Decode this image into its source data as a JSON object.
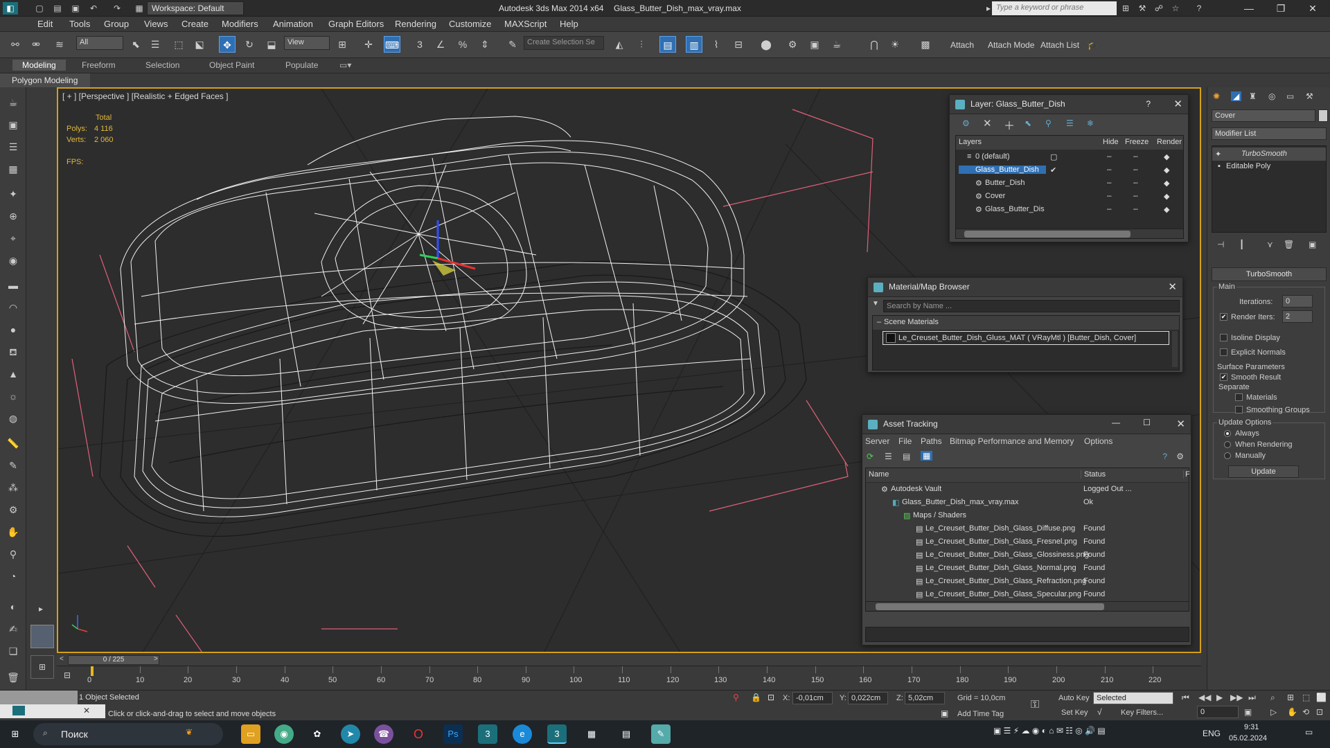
{
  "title_bar": {
    "app": "Autodesk 3ds Max  2014 x64",
    "file": "Glass_Butter_Dish_max_vray.max",
    "workspace": "Workspace: Default",
    "search_placeholder": "Type a keyword or phrase"
  },
  "menu": [
    "Edit",
    "Tools",
    "Group",
    "Views",
    "Create",
    "Modifiers",
    "Animation",
    "Graph Editors",
    "Rendering",
    "Customize",
    "MAXScript",
    "Help"
  ],
  "toolbar": {
    "filter": "All",
    "view": "View",
    "selection_set": "Create Selection Se",
    "attach": "Attach",
    "attach_mode": "Attach Mode",
    "attach_list": "Attach List"
  },
  "ribbon": {
    "tabs": [
      "Modeling",
      "Freeform",
      "Selection",
      "Object Paint",
      "Populate"
    ],
    "active": "Modeling",
    "panel": "Polygon Modeling"
  },
  "viewport": {
    "label": "[ + ] [Perspective ] [Realistic + Edged Faces ]",
    "stats_header": "Total",
    "polys_label": "Polys:",
    "polys": "4 116",
    "verts_label": "Verts:",
    "verts": "2 060",
    "fps_label": "FPS:"
  },
  "layer_window": {
    "title": "Layer: Glass_Butter_Dish",
    "help": "?",
    "columns": [
      "Layers",
      "Hide",
      "Freeze",
      "Render"
    ],
    "rows": [
      {
        "name": "0 (default)",
        "selected": false,
        "indent": 0
      },
      {
        "name": "Glass_Butter_Dish",
        "selected": true,
        "indent": 0
      },
      {
        "name": "Butter_Dish",
        "selected": false,
        "indent": 1
      },
      {
        "name": "Cover",
        "selected": false,
        "indent": 1
      },
      {
        "name": "Glass_Butter_Dis",
        "selected": false,
        "indent": 1
      }
    ]
  },
  "material_browser": {
    "title": "Material/Map Browser",
    "search_placeholder": "Search by Name ...",
    "section": "Scene Materials",
    "item": "Le_Creuset_Butter_Dish_Gluss_MAT  ( VRayMtl ) [Butter_Dish, Cover]"
  },
  "asset_tracking": {
    "title": "Asset Tracking",
    "menu": [
      "Server",
      "File",
      "Paths",
      "Bitmap Performance and Memory",
      "Options"
    ],
    "columns": [
      "Name",
      "Status",
      "F"
    ],
    "rows": [
      {
        "name": "Autodesk Vault",
        "status": "Logged Out ...",
        "indent": 1
      },
      {
        "name": "Glass_Butter_Dish_max_vray.max",
        "status": "Ok",
        "indent": 2
      },
      {
        "name": "Maps / Shaders",
        "status": "",
        "indent": 3
      },
      {
        "name": "Le_Creuset_Butter_Dish_Glass_Diffuse.png",
        "status": "Found",
        "indent": 4
      },
      {
        "name": "Le_Creuset_Butter_Dish_Glass_Fresnel.png",
        "status": "Found",
        "indent": 4
      },
      {
        "name": "Le_Creuset_Butter_Dish_Glass_Glossiness.png",
        "status": "Found",
        "indent": 4
      },
      {
        "name": "Le_Creuset_Butter_Dish_Glass_Normal.png",
        "status": "Found",
        "indent": 4
      },
      {
        "name": "Le_Creuset_Butter_Dish_Glass_Refraction.png",
        "status": "Found",
        "indent": 4
      },
      {
        "name": "Le_Creuset_Butter_Dish_Glass_Specular.png",
        "status": "Found",
        "indent": 4
      }
    ]
  },
  "command_panel": {
    "object_name": "Cover",
    "modifier_list": "Modifier List",
    "stack": [
      "TurboSmooth",
      "Editable Poly"
    ],
    "rollout_title": "TurboSmooth",
    "main_label": "Main",
    "iterations_label": "Iterations:",
    "iterations": "0",
    "render_iters_label": "Render Iters:",
    "render_iters": "2",
    "isoline_label": "Isoline Display",
    "explicit_normals_label": "Explicit Normals",
    "surface_params_label": "Surface Parameters",
    "smooth_result_label": "Smooth Result",
    "separate_label": "Separate",
    "materials_label": "Materials",
    "smoothing_groups_label": "Smoothing Groups",
    "update_options_label": "Update Options",
    "always_label": "Always",
    "when_rendering_label": "When Rendering",
    "manually_label": "Manually",
    "update_button": "Update"
  },
  "timeline": {
    "frame": "0 / 225",
    "ticks": [
      "0",
      "10",
      "20",
      "30",
      "40",
      "50",
      "60",
      "70",
      "80",
      "90",
      "100",
      "110",
      "120",
      "130",
      "140",
      "150",
      "160",
      "170",
      "180",
      "190",
      "200",
      "210",
      "220"
    ]
  },
  "status": {
    "selected": "1 Object Selected",
    "prompt": "Click or click-and-drag to select and move objects",
    "x_label": "X:",
    "x": "-0,01cm",
    "y_label": "Y:",
    "y": "0,022cm",
    "z_label": "Z:",
    "z": "5,02cm",
    "grid": "Grid = 10,0cm",
    "add_time_tag": "Add Time Tag",
    "auto_key": "Auto Key",
    "set_key": "Set Key",
    "selected_dd": "Selected",
    "key_filters": "Key Filters...",
    "frame_field": "0"
  },
  "taskbar": {
    "search": "Поиск",
    "lang": "ENG",
    "time": "9:31",
    "date": "05.02.2024"
  }
}
